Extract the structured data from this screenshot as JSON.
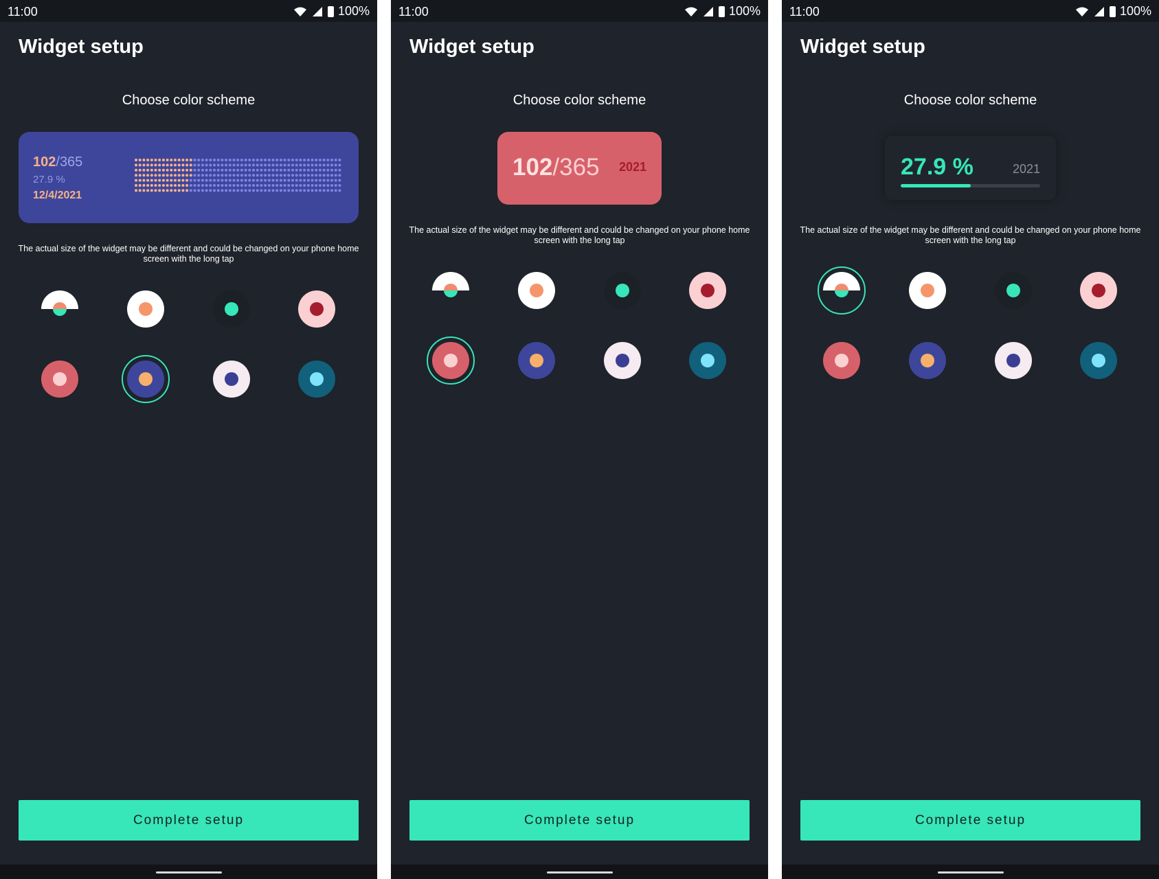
{
  "status_bar": {
    "time": "11:00",
    "battery": "100%"
  },
  "screens": [
    {
      "title": "Widget setup",
      "subtitle": "Choose color scheme",
      "widget": {
        "days": "102",
        "separator": "/",
        "total": "365",
        "percent": "27.9 %",
        "date": "12/4/2021"
      },
      "note": "The actual size of the widget may be different and could be changed on your phone home screen with the long tap",
      "selected_scheme": 5,
      "button": "Complete setup"
    },
    {
      "title": "Widget setup",
      "subtitle": "Choose color scheme",
      "widget": {
        "days": "102",
        "separator": "/",
        "total": "365",
        "year": "2021"
      },
      "note": "The actual size of the widget may be different and could be changed on your phone home screen with the long tap",
      "selected_scheme": 4,
      "button": "Complete setup"
    },
    {
      "title": "Widget setup",
      "subtitle": "Choose color scheme",
      "widget": {
        "percent": "27.9 %",
        "year": "2021",
        "progress": 0.5
      },
      "note": "The actual size of the widget may be different and could be changed on your phone home screen with the long tap",
      "selected_scheme": 0,
      "button": "Complete setup"
    }
  ],
  "color_schemes": [
    {
      "name": "split-dark-light",
      "outer": "split",
      "outer_top": "#ffffff",
      "outer_bottom": "#1f232b",
      "inner": "#f08b6f",
      "inner_bottom": "#37e6b9"
    },
    {
      "name": "white-orange",
      "outer": "#ffffff",
      "inner": "#f5956b"
    },
    {
      "name": "dark-teal",
      "outer": "#1c2027",
      "inner": "#37e6b9"
    },
    {
      "name": "pink-crimson",
      "outer": "#fbd0d2",
      "inner": "#a51d2d"
    },
    {
      "name": "red-pink",
      "outer": "#d7616a",
      "inner": "#fbd0d1"
    },
    {
      "name": "indigo-orange",
      "outer": "#3e469b",
      "inner": "#f7b06a"
    },
    {
      "name": "blush-indigo",
      "outer": "#f5ebf0",
      "inner": "#3b3f94"
    },
    {
      "name": "teal-cyan",
      "outer": "#11607c",
      "inner": "#7fe4fb"
    }
  ],
  "colors": {
    "background": "#1f232b",
    "accent": "#37e6b9",
    "statusbar": "#15181d"
  }
}
